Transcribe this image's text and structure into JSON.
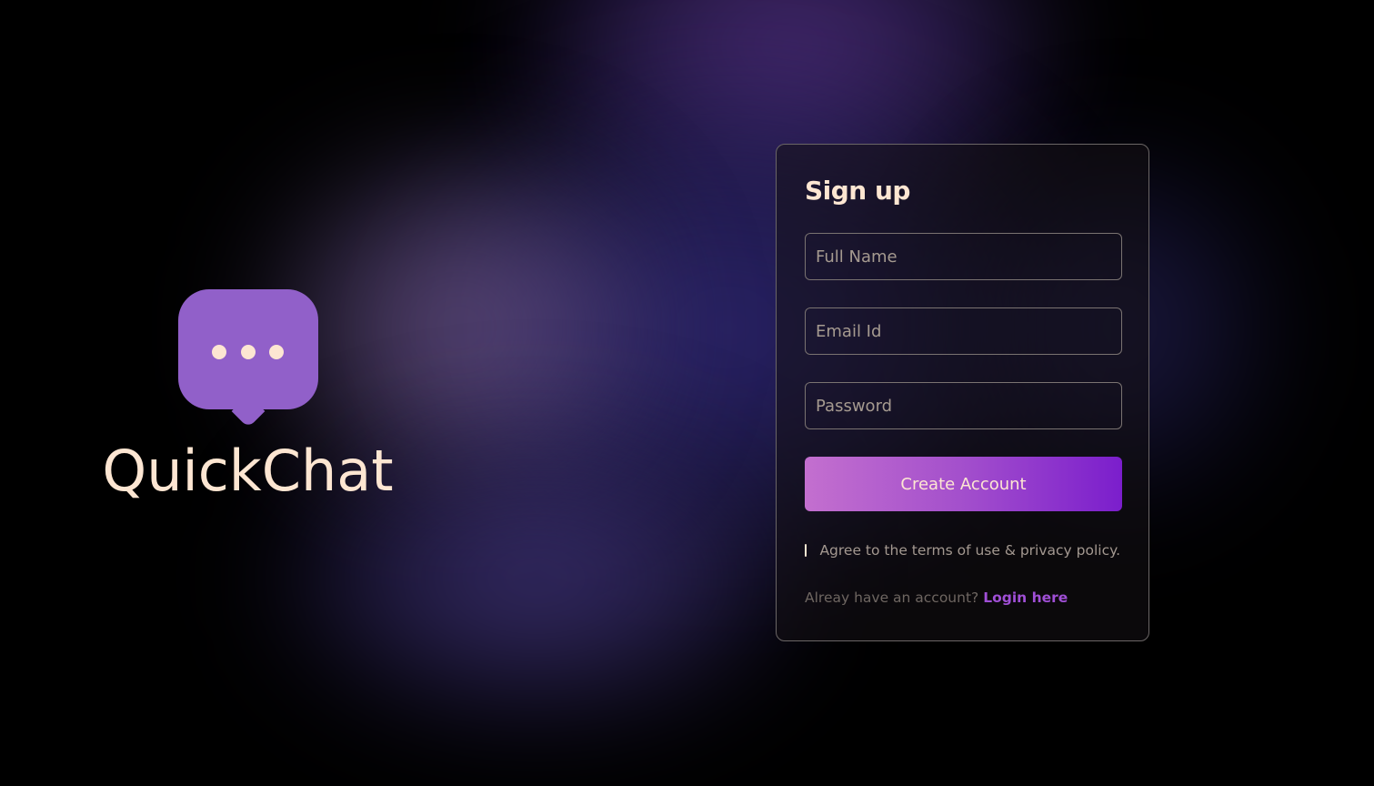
{
  "brand": {
    "name": "QuickChat",
    "logo_icon": "chat-bubble-icon"
  },
  "signup": {
    "title": "Sign up",
    "full_name_placeholder": "Full Name",
    "email_placeholder": "Email Id",
    "password_placeholder": "Password",
    "create_button_label": "Create Account",
    "agree_label": "Agree to the terms of use & privacy policy.",
    "login_prompt": "Alreay have an account?",
    "login_link_label": "Login here"
  },
  "colors": {
    "accent": "#9160c9",
    "text_primary": "#fde6d2",
    "button_gradient_start": "#c36fcf",
    "button_gradient_end": "#7b1ecc",
    "link": "#a04fd6"
  }
}
